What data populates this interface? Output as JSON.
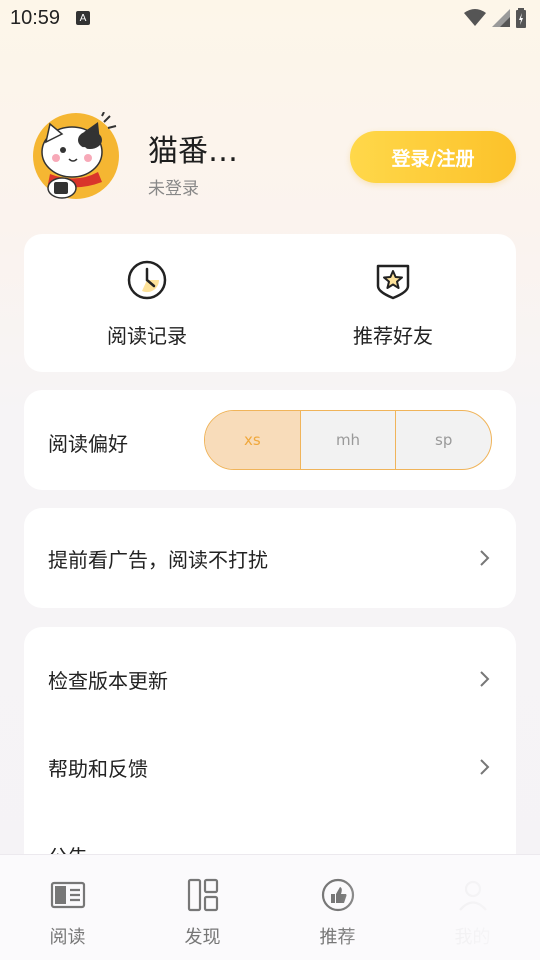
{
  "status_bar": {
    "time": "10:59",
    "indicator": "A"
  },
  "profile": {
    "nickname": "猫番…",
    "login_status": "未登录",
    "login_button": "登录/注册"
  },
  "quick_actions": [
    {
      "label": "阅读记录",
      "icon": "clock-icon"
    },
    {
      "label": "推荐好友",
      "icon": "star-badge-icon"
    }
  ],
  "preference": {
    "label": "阅读偏好",
    "options": [
      "xs",
      "mh",
      "sp"
    ],
    "selected": "xs"
  },
  "ad_row": {
    "label": "提前看广告，阅读不打扰"
  },
  "menu": [
    {
      "label": "检查版本更新"
    },
    {
      "label": "帮助和反馈"
    },
    {
      "label": "公告"
    }
  ],
  "tabs": [
    {
      "label": "阅读",
      "icon": "book-icon"
    },
    {
      "label": "发现",
      "icon": "grid-icon"
    },
    {
      "label": "推荐",
      "icon": "thumbs-up-icon"
    },
    {
      "label": "我的",
      "icon": "person-icon"
    }
  ],
  "colors": {
    "accent": "#fcc22a",
    "segment_active_bg": "#f8dcba",
    "segment_border": "#f0b45a"
  }
}
